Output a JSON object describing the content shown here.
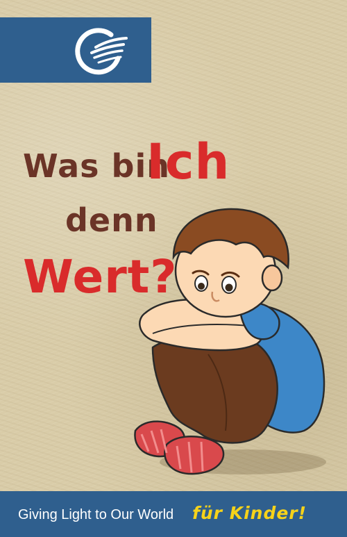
{
  "cover": {
    "title_line1": "Was bin",
    "title_emphasis": "Ich",
    "title_line2": "denn",
    "title_line3": "Wert?"
  },
  "footer": {
    "tagline": "Giving Light to Our World",
    "series": "für Kinder!"
  },
  "colors": {
    "brand_blue": "#2f5f8e",
    "title_brown": "#6b3427",
    "title_red": "#d92b2b",
    "series_yellow": "#f6d21a",
    "background": "#d9cca8"
  },
  "icons": {
    "logo": "publisher-logo-icon",
    "illustration": "sad-boy-illustration"
  }
}
